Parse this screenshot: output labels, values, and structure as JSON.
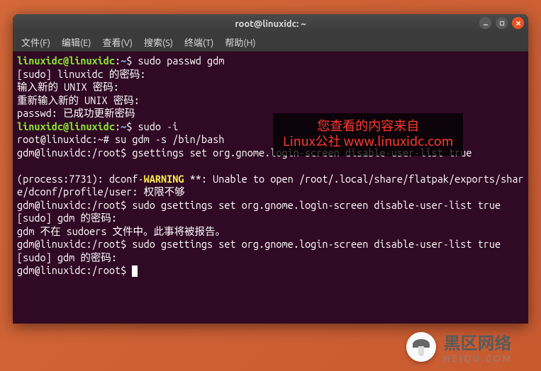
{
  "titlebar": {
    "title": "root@linuxidc: ~"
  },
  "menu": {
    "file": "文件(F)",
    "edit": "编辑(E)",
    "view": "查看(V)",
    "search": "搜索(S)",
    "terminal": "终端(T)",
    "help": "帮助(H)"
  },
  "terminal": {
    "l1_prompt_user": "linuxidc@linuxidc",
    "l1_colon": ":",
    "l1_path": "~",
    "l1_cmd": "$ sudo passwd gdm",
    "l2": "[sudo] linuxidc 的密码: ",
    "l3": "输入新的 UNIX 密码: ",
    "l4": "重新输入新的 UNIX 密码: ",
    "l5": "passwd: 已成功更新密码",
    "l6_prompt_user": "linuxidc@linuxidc",
    "l6_colon": ":",
    "l6_path": "~",
    "l6_cmd": "$ sudo -i",
    "l7": "root@linuxidc:~# su gdm -s /bin/bash",
    "l8": "gdm@linuxidc:/root$ gsettings set org.gnome.login-screen disable-user-list true",
    "blank1": "",
    "l9a": "(process:7731): dconf-",
    "l9warn": "WARNING",
    "l9b": " **: Unable to open /root/.local/share/flatpak/exports/share/dconf/profile/user: 权限不够",
    "l10": "gdm@linuxidc:/root$ sudo gsettings set org.gnome.login-screen disable-user-list true",
    "l11": "[sudo] gdm 的密码: ",
    "l12": "gdm 不在 sudoers 文件中。此事将被报告。",
    "l13": "gdm@linuxidc:/root$ sudo gsettings set org.gnome.login-screen disable-user-list true",
    "l14": "[sudo] gdm 的密码: ",
    "l15": "gdm@linuxidc:/root$ "
  },
  "watermark": {
    "line1": "您查看的内容来自",
    "line2": "Linux公社 www.linuxidc.com"
  },
  "footer_logo": {
    "cn": "黑区网络",
    "en": "HEIQU.COM"
  }
}
